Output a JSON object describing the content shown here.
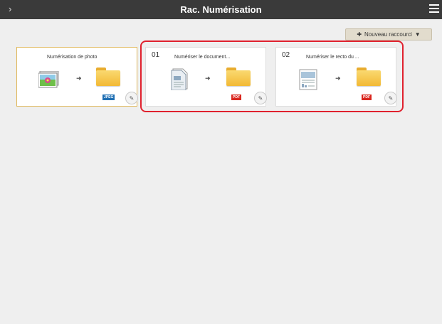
{
  "window": {
    "title": "Rac. Numérisation",
    "left_glyph": "›"
  },
  "toolbar": {
    "new_shortcut_label": "Nouveau raccourci",
    "new_shortcut_icon": "plus-icon",
    "dropdown_icon": "caret-down-icon"
  },
  "shortcuts": [
    {
      "number": "",
      "name": "Numérisation de photo",
      "format": "JPEG",
      "format_color": "#1f6fb3"
    },
    {
      "number": "01",
      "name": "Numériser le document...",
      "format": "PDF",
      "format_color": "#d9271f"
    },
    {
      "number": "02",
      "name": "Numériser le recto du ...",
      "format": "PDF",
      "format_color": "#d9271f"
    }
  ],
  "colors": {
    "titlebar": "#3a3a3a",
    "selected_card_border": "#e0b85c",
    "highlight": "#e0212e"
  }
}
